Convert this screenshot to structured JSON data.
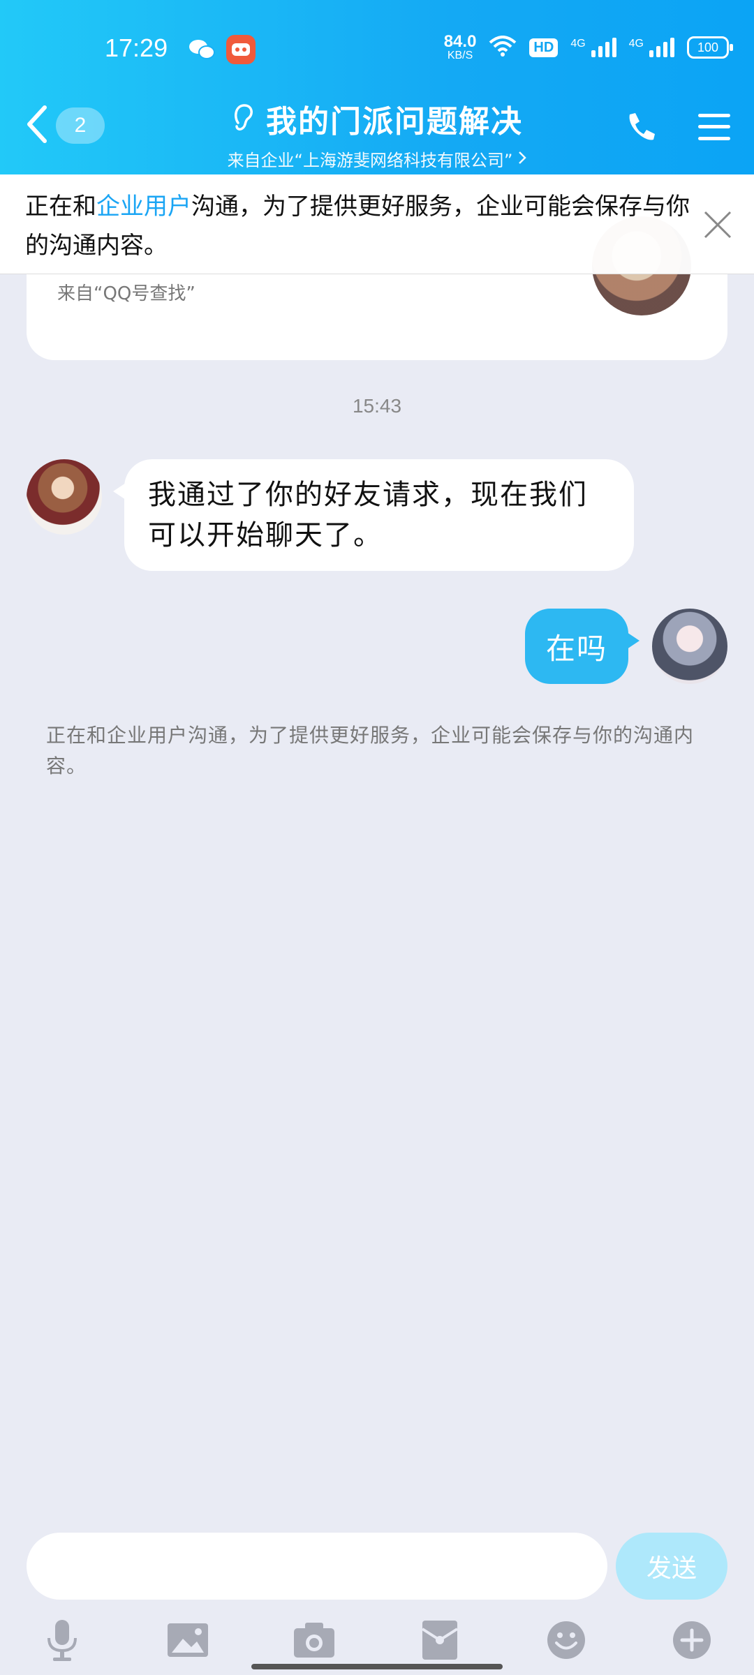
{
  "status_bar": {
    "time": "17:29",
    "net_speed_value": "84.0",
    "net_speed_unit": "KB/S",
    "hd_label": "HD",
    "signal1_label": "4G",
    "signal2_label": "4G",
    "battery": "100"
  },
  "header": {
    "unread_count": "2",
    "title": "我的门派问题解决",
    "subtitle": "来自企业“上海游斐网络科技有限公司”"
  },
  "notice": {
    "prefix": "正在和",
    "highlight": "企业用户",
    "suffix": "沟通，为了提供更好服务，企业可能会保存与你的沟通内容。",
    "highlight_color": "#1aa5f4"
  },
  "card": {
    "source": "来自“QQ号查找”"
  },
  "chat": {
    "timestamp": "15:43",
    "messages": [
      {
        "side": "left",
        "text": "我通过了你的好友请求，现在我们可以开始聊天了。"
      },
      {
        "side": "right",
        "text": "在吗"
      }
    ],
    "system_note": "正在和企业用户沟通，为了提供更好服务，企业可能会保存与你的沟通内容。"
  },
  "input": {
    "placeholder": "",
    "send_label": "发送"
  },
  "toolbar": {
    "items": [
      "microphone-icon",
      "image-icon",
      "camera-icon",
      "red-packet-icon",
      "emoji-icon",
      "plus-icon"
    ]
  },
  "colors": {
    "header_start": "#22c9f8",
    "header_end": "#0ba4f5",
    "bubble_right": "#2db8f2",
    "send_disabled": "#aee8fb"
  }
}
